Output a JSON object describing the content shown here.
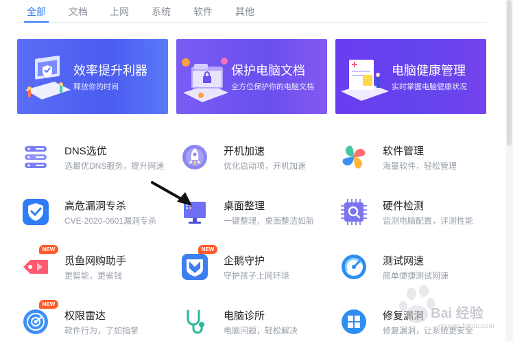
{
  "tabs": [
    {
      "label": "全部",
      "active": true
    },
    {
      "label": "文档",
      "active": false
    },
    {
      "label": "上网",
      "active": false
    },
    {
      "label": "系统",
      "active": false
    },
    {
      "label": "软件",
      "active": false
    },
    {
      "label": "其他",
      "active": false
    }
  ],
  "banners": [
    {
      "title": "效率提升利器",
      "subtitle": "释放你的时间"
    },
    {
      "title": "保护电脑文档",
      "subtitle": "全方位保护你的电脑文档"
    },
    {
      "title": "电脑健康管理",
      "subtitle": "实时掌握电脑健康状况"
    }
  ],
  "tools": [
    {
      "name": "DNS选优",
      "desc": "选最优DNS服务，提升网速",
      "icon": "dns-server-icon"
    },
    {
      "name": "开机加速",
      "desc": "优化启动项，开机加速",
      "icon": "rocket-icon"
    },
    {
      "name": "软件管理",
      "desc": "海量软件，轻松管理",
      "icon": "petals-icon"
    },
    {
      "name": "高危漏洞专杀",
      "desc": "CVE-2020-0601漏洞专杀",
      "icon": "shield-icon"
    },
    {
      "name": "桌面整理",
      "desc": "一键整理，桌面整洁如新",
      "icon": "monitor-icon"
    },
    {
      "name": "硬件检测",
      "desc": "监测电脑配置，评测性能",
      "icon": "chip-search-icon"
    },
    {
      "name": "觅鱼网购助手",
      "desc": "更智能，更省钱",
      "icon": "price-tag-icon",
      "badge": "NEW"
    },
    {
      "name": "企鹅守护",
      "desc": "守护孩子上网环境",
      "icon": "guard-shield-icon",
      "badge": "NEW"
    },
    {
      "name": "测试网速",
      "desc": "简单便捷测试网速",
      "icon": "speedometer-icon"
    },
    {
      "name": "权限雷达",
      "desc": "软件行为，了如指掌",
      "icon": "radar-icon",
      "badge": "NEW"
    },
    {
      "name": "电脑诊所",
      "desc": "电脑问题，轻松解决",
      "icon": "stethoscope-icon"
    },
    {
      "name": "修复漏洞",
      "desc": "修复漏洞，让系统更安全",
      "icon": "windows-icon"
    }
  ],
  "watermark": {
    "text": "Bai 经验",
    "sub": "jingyan.baidu.com"
  },
  "colors": {
    "accent": "#2f7df6",
    "badge": "#ff5a2a"
  }
}
